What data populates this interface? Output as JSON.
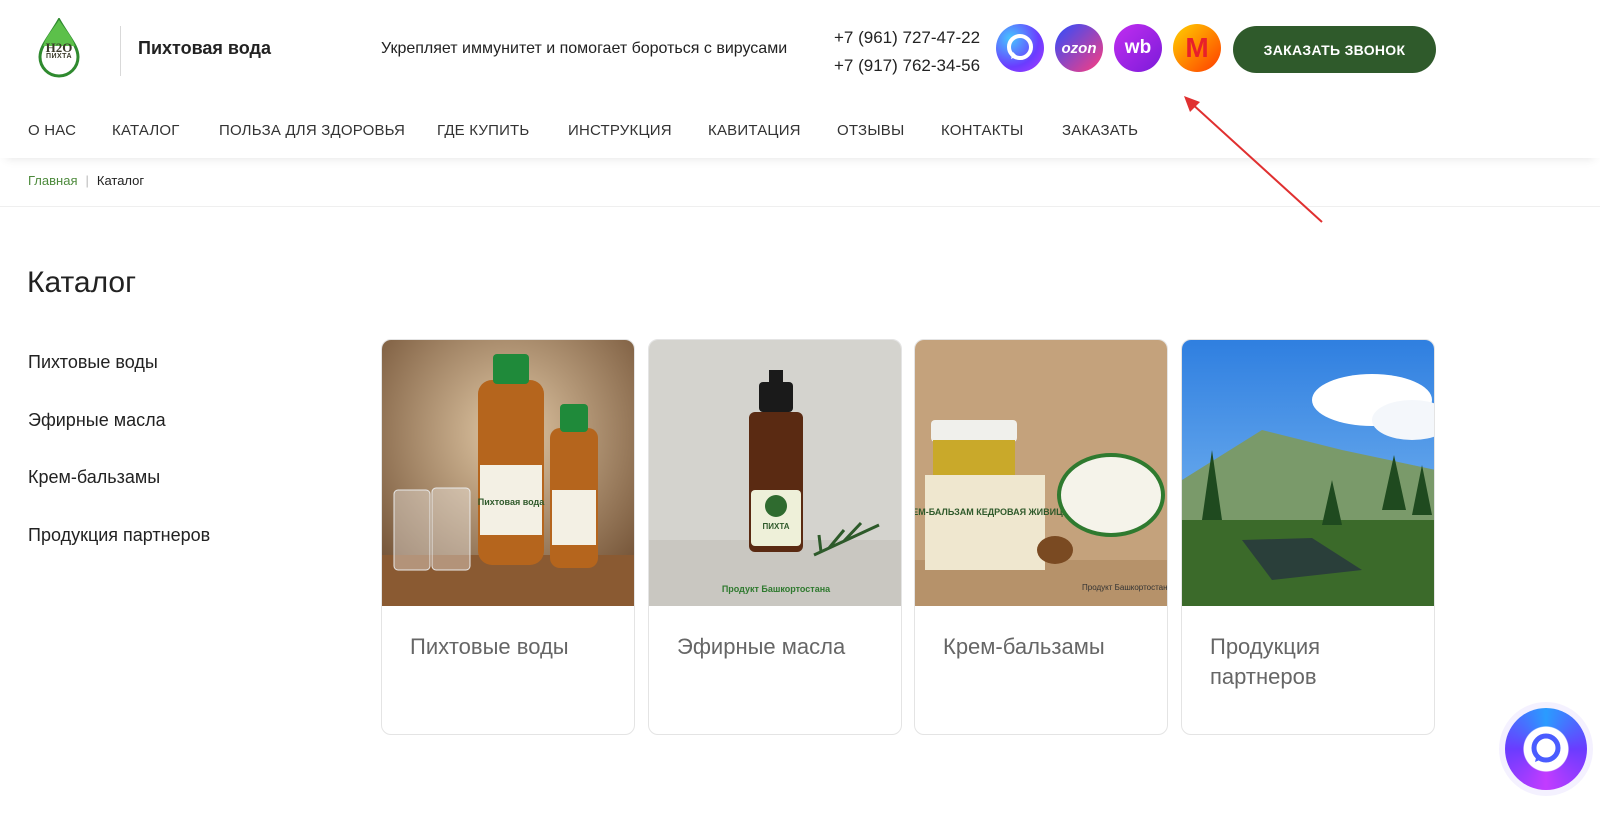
{
  "header": {
    "site_name": "Пихтовая вода",
    "logo_text": "H2O",
    "logo_sub": "ПИХТА",
    "tagline": "Укрепляет иммунитет и помогает бороться с вирусами",
    "phones": [
      "+7 (961) 727-47-22",
      "+7 (917) 762-34-56"
    ],
    "marketplaces": [
      {
        "name": "max-icon",
        "glyph": ""
      },
      {
        "name": "ozon-icon",
        "glyph": "ozon"
      },
      {
        "name": "wildberries-icon",
        "glyph": "wb"
      },
      {
        "name": "yandex-market-icon",
        "glyph": "M"
      }
    ],
    "order_call_label": "ЗАКАЗАТЬ ЗВОНОК"
  },
  "nav": {
    "items": [
      "О НАС",
      "КАТАЛОГ",
      "ПОЛЬЗА ДЛЯ ЗДОРОВЬЯ",
      "ГДЕ КУПИТЬ",
      "ИНСТРУКЦИЯ",
      "КАВИТАЦИЯ",
      "ОТЗЫВЫ",
      "КОНТАКТЫ",
      "ЗАКАЗАТЬ"
    ]
  },
  "breadcrumb": {
    "home": "Главная",
    "separator": "|",
    "current": "Каталог"
  },
  "page_title": "Каталог",
  "sidebar": {
    "items": [
      "Пихтовые воды",
      "Эфирные масла",
      "Крем-бальзамы",
      "Продукция партнеров"
    ]
  },
  "cards": [
    {
      "title": "Пихтовые воды",
      "bottle_label": "Пихтовая вода"
    },
    {
      "title": "Эфирные масла",
      "bottle_label": "ПИХТА",
      "image_caption": "Продукт Башкортостана"
    },
    {
      "title": "Крем-бальзамы",
      "jar_label": "КРЕМ-БАЛЬЗАМ КЕДРОВАЯ ЖИВИЦА",
      "image_caption": "Продукт Башкортостана"
    },
    {
      "title": "Продукция партнеров"
    }
  ],
  "colors": {
    "accent_green": "#2f5a2b",
    "breadcrumb_green": "#4d8a3c",
    "arrow_red": "#e03030"
  }
}
